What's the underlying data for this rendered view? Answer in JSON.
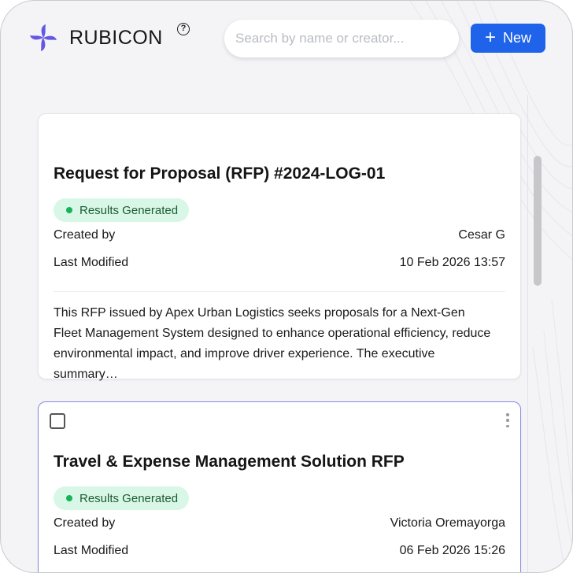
{
  "header": {
    "brand_name": "RUBICON",
    "help_glyph": "?",
    "search_placeholder": "Search by name or creator...",
    "new_button_label": "New",
    "new_button_icon": "plus-icon"
  },
  "colors": {
    "accent": "#1e63ea",
    "logo": "#6457e8",
    "badge_bg": "#d9f7e6",
    "badge_dot": "#17b35a",
    "selected_border": "#8a88e8"
  },
  "cards": [
    {
      "title": "Request for Proposal (RFP) #2024-LOG-01",
      "status": "Results Generated",
      "created_by_label": "Created by",
      "created_by": "Cesar G",
      "last_modified_label": "Last Modified",
      "last_modified": "10 Feb 2026 13:57",
      "summary": "This RFP issued by Apex Urban Logistics seeks proposals for a Next-Gen Fleet Management System designed to enhance operational efficiency, reduce environmental impact, and improve driver experience. The executive summary…"
    },
    {
      "title": "Travel & Expense Management Solution RFP",
      "status": "Results Generated",
      "created_by_label": "Created by",
      "created_by": "Victoria Oremayorga",
      "last_modified_label": "Last Modified",
      "last_modified": "06 Feb 2026 15:26",
      "checkbox_checked": false
    }
  ]
}
